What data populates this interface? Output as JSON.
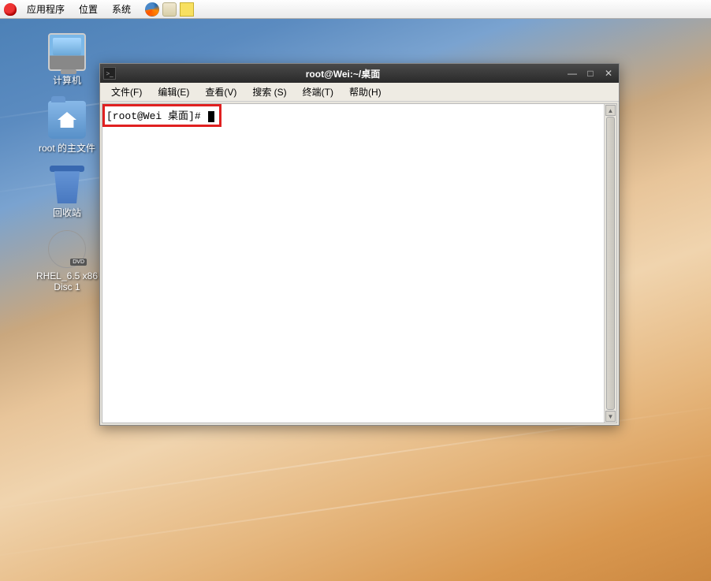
{
  "panel": {
    "menus": [
      "应用程序",
      "位置",
      "系统"
    ]
  },
  "desktop": {
    "icons": [
      {
        "label": "计算机"
      },
      {
        "label": "root 的主文件"
      },
      {
        "label": "回收站"
      },
      {
        "label": "RHEL_6.5 x86\nDisc 1"
      }
    ]
  },
  "terminal": {
    "title": "root@Wei:~/桌面",
    "menus": [
      "文件(F)",
      "编辑(E)",
      "查看(V)",
      "搜索 (S)",
      "终端(T)",
      "帮助(H)"
    ],
    "prompt": "[root@Wei 桌面]# "
  },
  "colors": {
    "highlight": "#e02020"
  }
}
